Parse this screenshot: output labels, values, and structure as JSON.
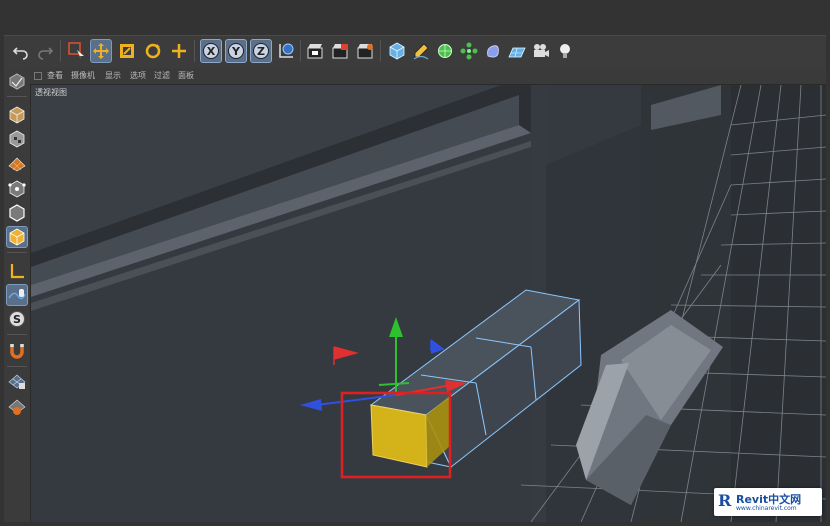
{
  "menubar": {
    "items": [
      "查看",
      "摄像机",
      "显示",
      "选项",
      "过滤",
      "面板"
    ]
  },
  "viewport": {
    "label": "透视视图"
  },
  "toolbar": {
    "icons": [
      "undo-icon",
      "redo-icon",
      "live-selection-icon",
      "move-icon",
      "scale-icon",
      "rotate-icon",
      "add-icon",
      "x-axis-icon",
      "y-axis-icon",
      "z-axis-icon",
      "world-coordinates-icon",
      "render-view-icon",
      "render-picture-viewer-icon",
      "render-settings-icon",
      "cube-icon",
      "pen-icon",
      "subdivision-icon",
      "array-icon",
      "deformer-icon",
      "floor-icon",
      "camera-icon",
      "light-icon"
    ],
    "axis_labels": {
      "x": "X",
      "y": "Y",
      "z": "Z"
    }
  },
  "sidebar": {
    "icons": [
      "make-editable-icon",
      "model-mode-icon",
      "texture-mode-icon",
      "points-mode-icon",
      "edges-mode-icon",
      "polygons-mode-icon",
      "axis-mode-icon",
      "tweak-mode-icon",
      "solo-icon",
      "snap-icon",
      "workplane-icon",
      "locked-workplane-icon"
    ],
    "solo_label": "S"
  },
  "colors": {
    "accent": "#5a6f8a",
    "selection_highlight": "#e02020",
    "selected_polygon": "#d4b21a",
    "axis_x": "#e03030",
    "axis_y": "#2ec02e",
    "axis_z": "#3050e0"
  },
  "watermark": {
    "logo": "R",
    "title": "Revit中文网",
    "url": "www.chinarevit.com"
  }
}
